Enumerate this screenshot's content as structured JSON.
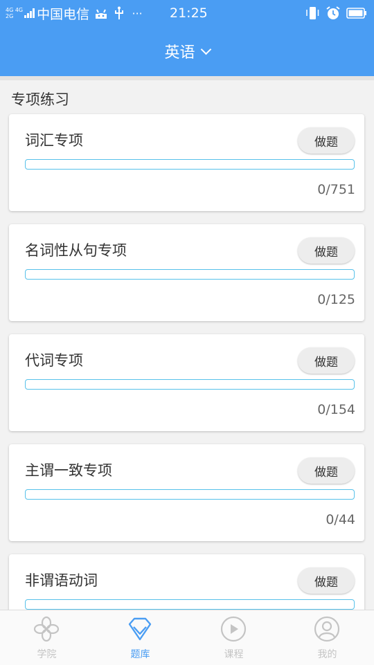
{
  "status_bar": {
    "network_top": "4G 4G",
    "network_bottom": "2G",
    "carrier": "中国电信",
    "more": "···",
    "time": "21:25"
  },
  "header": {
    "title": "英语"
  },
  "section": {
    "title": "专项练习"
  },
  "cards": [
    {
      "title": "词汇专项",
      "button": "做题",
      "count": "0/751",
      "progress": 0
    },
    {
      "title": "名词性从句专项",
      "button": "做题",
      "count": "0/125",
      "progress": 0
    },
    {
      "title": "代词专项",
      "button": "做题",
      "count": "0/154",
      "progress": 0
    },
    {
      "title": "主谓一致专项",
      "button": "做题",
      "count": "0/44",
      "progress": 0
    },
    {
      "title": "非谓语动词",
      "button": "做题",
      "count": "",
      "progress": 0
    }
  ],
  "tabs": [
    {
      "label": "学院",
      "icon": "college-icon",
      "active": false
    },
    {
      "label": "题库",
      "icon": "question-bank-icon",
      "active": true
    },
    {
      "label": "课程",
      "icon": "play-icon",
      "active": false
    },
    {
      "label": "我的",
      "icon": "profile-icon",
      "active": false
    }
  ],
  "colors": {
    "primary": "#4a9df3",
    "progress_border": "#56c1ea",
    "inactive_tab": "#c4c4c4"
  }
}
